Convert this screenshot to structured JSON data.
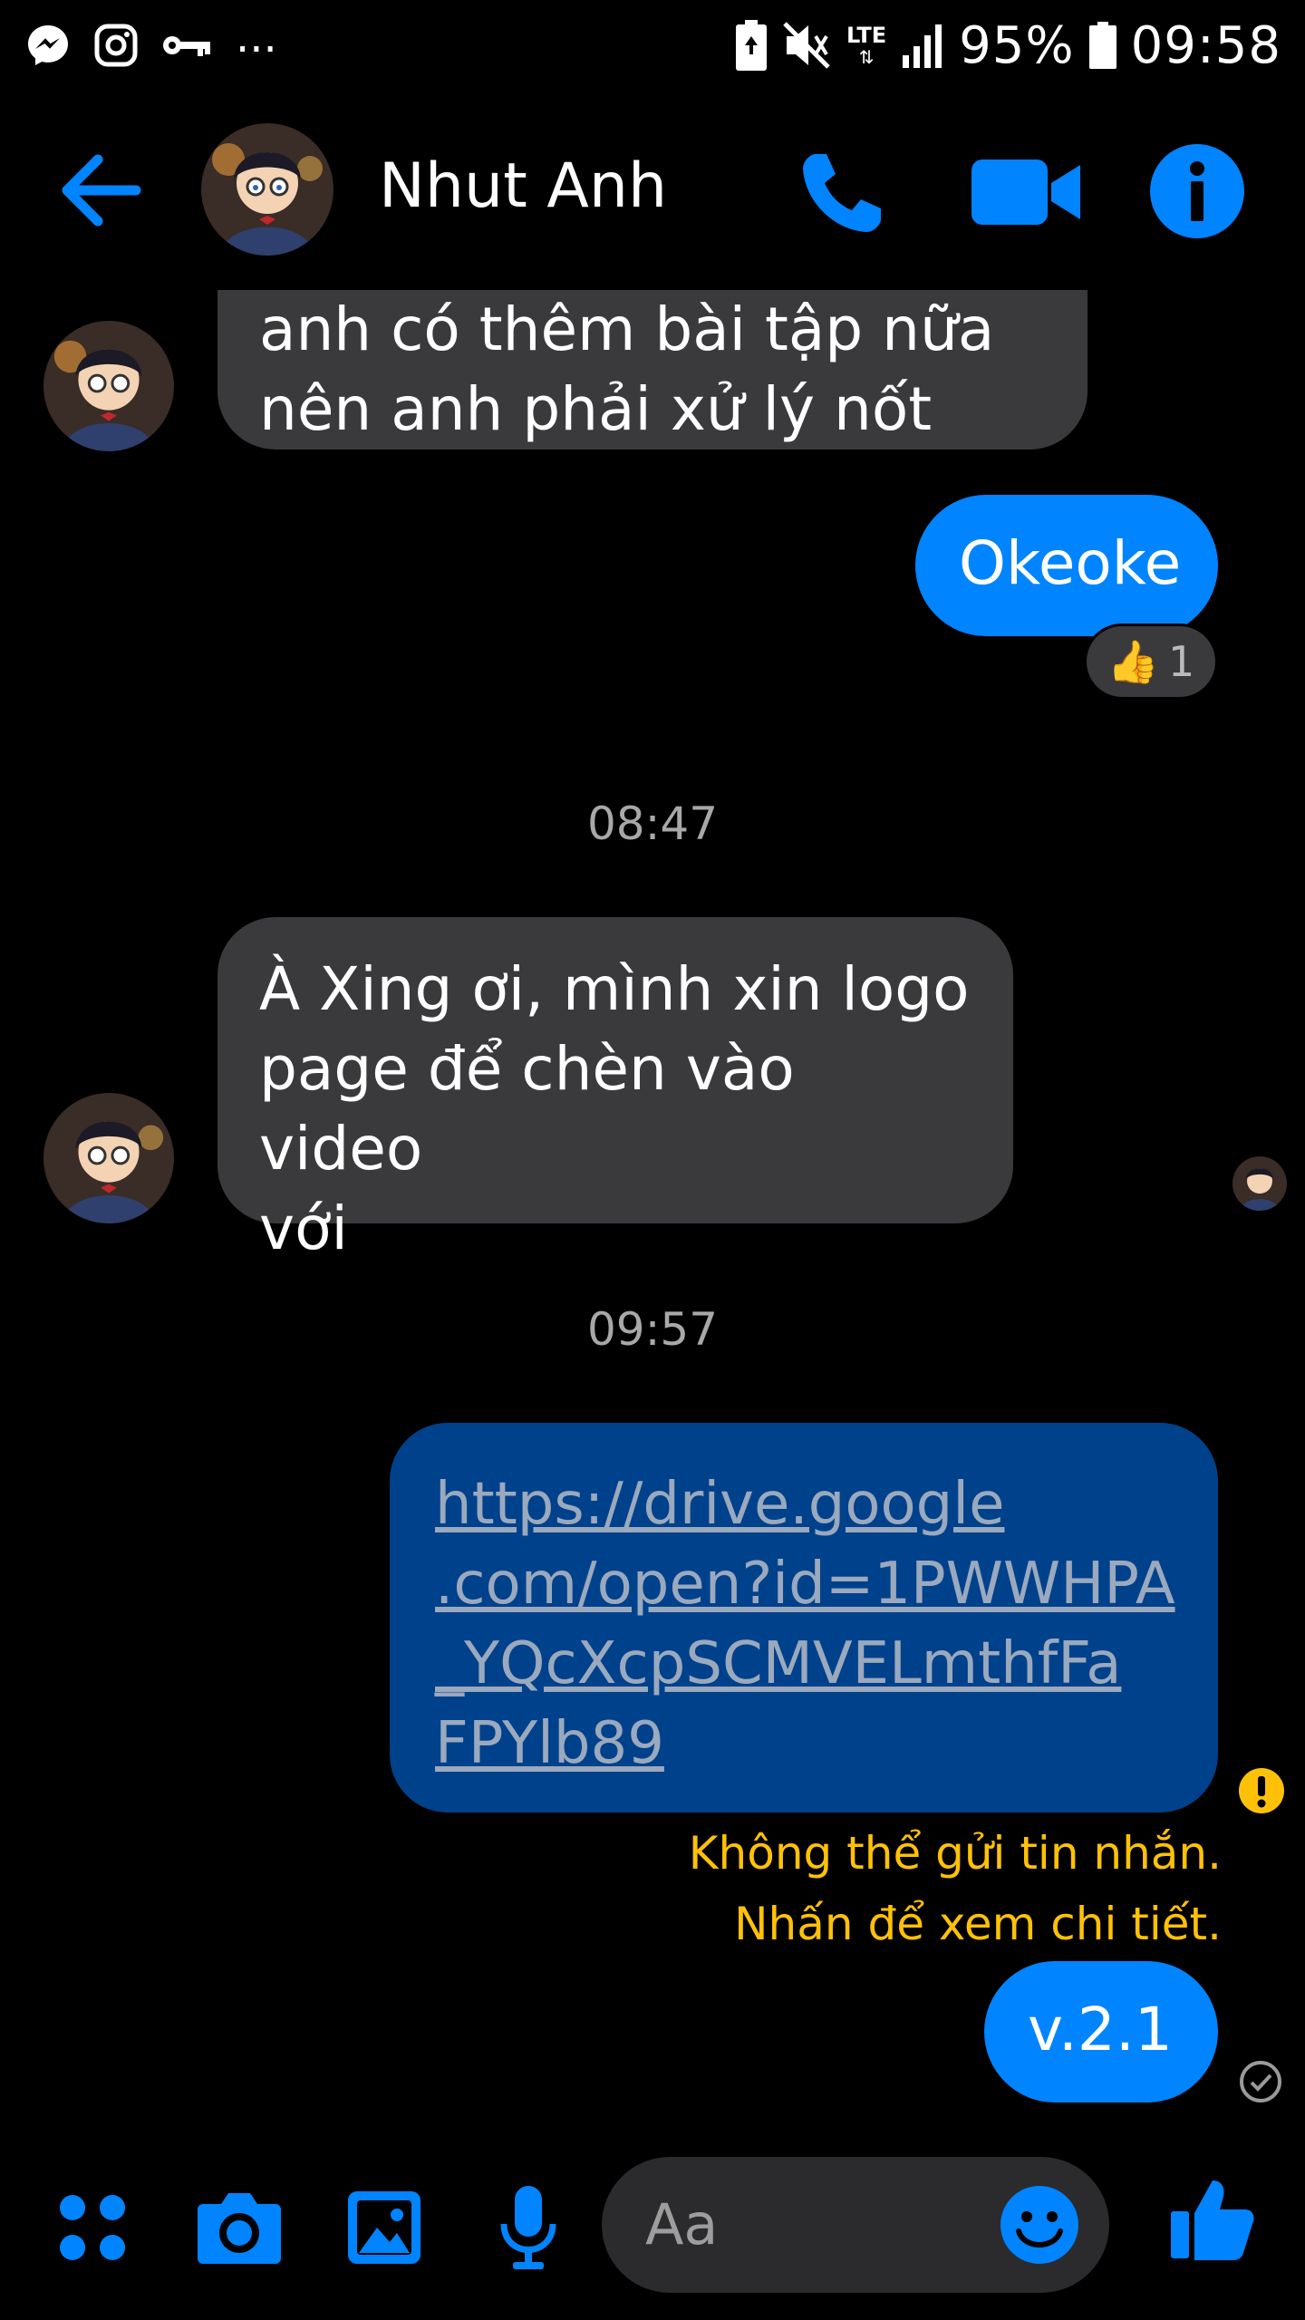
{
  "status_bar": {
    "battery": "95%",
    "time": "09:58",
    "network": "LTE",
    "overflow": "..."
  },
  "header": {
    "contact_name": "Nhut Anh",
    "icons": [
      "back-arrow-icon",
      "phone-icon",
      "video-camera-icon",
      "info-icon"
    ]
  },
  "messages": [
    {
      "from": "them",
      "text_lines": [
        "anh có thêm bài tập nữa",
        "nên anh phải xử lý nốt"
      ]
    },
    {
      "from": "me",
      "text": "Okeoke",
      "reaction": {
        "emoji": "👍",
        "count": "1"
      }
    },
    {
      "type": "timestamp",
      "text": "08:47"
    },
    {
      "from": "them",
      "text_lines": [
        "À Xing ơi, mình xin logo",
        "page để chèn vào video",
        "với"
      ]
    },
    {
      "type": "timestamp",
      "text": "09:57"
    },
    {
      "from": "me",
      "status": "failed",
      "link_lines": [
        "https://drive.google",
        ".com/open?id=1PWWHPA",
        "_YQcXcpSCMVELmthfFa",
        "FPYlb89"
      ]
    },
    {
      "type": "error",
      "lines": [
        "Không thể gửi tin nhắn.",
        "Nhấn để xem chi tiết."
      ]
    },
    {
      "from": "me",
      "text": "v.2.1",
      "status": "sent"
    }
  ],
  "composer": {
    "placeholder": "Aa"
  },
  "colors": {
    "accent": "#0084ff",
    "incoming_bubble": "#3a3a3c",
    "failed_bubble": "#00418c",
    "error": "#ffc107"
  }
}
